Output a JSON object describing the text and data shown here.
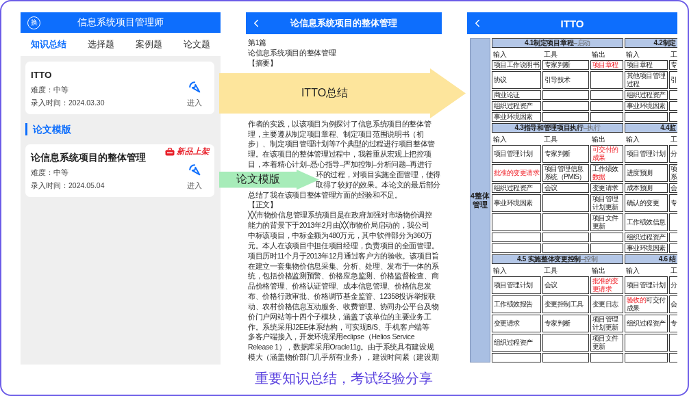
{
  "left_screen": {
    "header": {
      "logo_text": "换",
      "title": "信息系统项目管理师"
    },
    "tabs": [
      {
        "label": "知识总结",
        "selected": true
      },
      {
        "label": "选择题",
        "selected": false
      },
      {
        "label": "案例题",
        "selected": false
      },
      {
        "label": "论文题",
        "selected": false
      }
    ],
    "content": [
      {
        "kind": "card",
        "title": "ITTO",
        "difficulty": "难度：中等",
        "date": "录入时间：2024.03.30",
        "action": "进入"
      },
      {
        "kind": "heading",
        "text": "论文模版"
      },
      {
        "kind": "card",
        "badge": "新品上架",
        "title": "论信息系统项目的整体管理",
        "difficulty": "难度：中等",
        "date": "录入时间：2024.05.04",
        "action": "进入"
      }
    ]
  },
  "middle_screen": {
    "header": {
      "title": "论信息系统项目的整体管理"
    },
    "intro_lines": [
      "第1篇",
      "论信息系统项目的整体管理",
      "【摘要】"
    ],
    "abstract_lines": [
      {
        "kind": "full",
        "text": "作者的实践，以该项目为例探讨了信息系统项目的整体管"
      },
      {
        "kind": "full",
        "text": "理，主要遵从制定项目章程、制定项目范围说明书（初"
      },
      {
        "kind": "full",
        "text": "步）、制定项目管理计划等7个典型的过程进行项目整体管"
      },
      {
        "kind": "full",
        "text": "理。在该项目的整体管理过程中，我着重从宏观上把控项"
      },
      {
        "kind": "full",
        "text": "目，本着精心计划–悉心指导–严加控制–分析问题–再进行"
      },
      {
        "kind": "tail",
        "text": "环的过程，对项目实施全面管理，使得"
      },
      {
        "kind": "tail",
        "text": "取得了较好的效果。本论文的最后部分"
      },
      {
        "kind": "full",
        "text": "总结了我在该项目整体管理方面的经验和不足。"
      }
    ],
    "body_heading": "【正文】",
    "body_lines": [
      "╳╳市物价信息管理系统项目是在政府加强对市场物价调控",
      "能力的背景下于2013年2月由╳╳市物价局启动的，我公司",
      "中标该项目，中标金额为480万元，其中软件部分为360万",
      "元。本人在该项目中担任项目经理，负责项目的全面管理。",
      "项目历时11个月于2013年12月通过客户方的验收。该项目旨",
      "在建立一套集物价信息采集、分析、处理、发布于一体的系",
      "统，包括价格监测预警、价格应急监测、价格监督检查、商",
      "品价格管理、价格认证管理、成本信息管理、价格信息发",
      "布、价格行政审批、价格调节基金监管、12358投诉举报联",
      "动、农村价格信息互动服务、收费管理、协同办公平台及物",
      "价门户网站等十四个子模块，涵盖了该单位的主要业务工",
      "作。系统采用J2EE体系结构，可实现B/S、手机客户端等",
      "多客户端接入，开发环境采用eclipse（Helios Service",
      "Release 1），数据库采用Oracle11g。由于系统具有建设规",
      "模大（涵盖物价部门几乎所有业务），建设时间紧（建设期"
    ]
  },
  "right_screen": {
    "header": {
      "title": "ITTO"
    },
    "group_label": "4整体管理",
    "bands": [
      {
        "blocks": [
          {
            "title": "4.1制定项目章程",
            "phase": "–启动",
            "columns": [
              "输入",
              "工具",
              "输出"
            ],
            "rows": [
              [
                [
                  {
                    "text": "项目工作说明书",
                    "highlighted": false
                  }
                ],
                [
                  {
                    "text": "专家判断",
                    "highlighted": false
                  }
                ],
                [
                  {
                    "text": "项目章程",
                    "highlighted": true
                  }
                ]
              ],
              [
                [
                  {
                    "text": "协议",
                    "highlighted": false
                  }
                ],
                [
                  {
                    "text": "引导技术",
                    "highlighted": false
                  }
                ],
                null
              ],
              [
                [
                  {
                    "text": "商业论证",
                    "highlighted": false
                  }
                ],
                null,
                null
              ],
              [
                [
                  {
                    "text": "组织过程资产",
                    "highlighted": false
                  }
                ],
                null,
                null
              ],
              [
                [
                  {
                    "text": "事业环境因素",
                    "highlighted": false
                  }
                ],
                null,
                null
              ]
            ]
          },
          {
            "title": "4.2制定",
            "columns": [
              "输入",
              "工"
            ],
            "rows": [
              [
                [
                  {
                    "text": "项目章程",
                    "highlighted": false
                  }
                ],
                [
                  {
                    "text": "专",
                    "highlighted": false
                  }
                ]
              ],
              [
                [
                  {
                    "text": "其他项目管理过程",
                    "highlighted": false
                  }
                ],
                [
                  {
                    "text": "引",
                    "highlighted": false
                  }
                ]
              ],
              [
                [
                  {
                    "text": "组织过程资产",
                    "highlighted": false
                  }
                ],
                null
              ],
              [
                [
                  {
                    "text": "事业环境因素",
                    "highlighted": false
                  }
                ],
                null
              ],
              [
                null,
                null
              ]
            ]
          }
        ]
      },
      {
        "blocks": [
          {
            "title": "4.3指导和管理项目执行",
            "phase": "–执行",
            "columns": [
              "输入",
              "工具",
              "输出"
            ],
            "rows": [
              [
                [
                  {
                    "text": "项目管理计划",
                    "highlighted": false
                  }
                ],
                [
                  {
                    "text": "专家判断",
                    "highlighted": false
                  }
                ],
                [
                  {
                    "text": "可交付的成果",
                    "highlighted": true
                  }
                ]
              ],
              [
                [
                  {
                    "text": "批准的变更请求",
                    "highlighted": true
                  }
                ],
                [
                  {
                    "text": "项目管理信息系统（PMIS）",
                    "highlighted": false
                  }
                ],
                [
                  {
                    "text": "工作绩效",
                    "highlighted": false
                  },
                  {
                    "text": "数据",
                    "highlighted": true
                  }
                ]
              ],
              [
                [
                  {
                    "text": "组织过程资产",
                    "highlighted": false
                  }
                ],
                [
                  {
                    "text": "会议",
                    "highlighted": false
                  }
                ],
                [
                  {
                    "text": "变更请求",
                    "highlighted": false
                  }
                ]
              ],
              [
                [
                  {
                    "text": "事业环境因素",
                    "highlighted": false
                  }
                ],
                null,
                [
                  {
                    "text": "项目管理计划更新",
                    "highlighted": false
                  }
                ]
              ],
              [
                null,
                null,
                [
                  {
                    "text": "项目文件更新",
                    "highlighted": false
                  }
                ]
              ],
              [
                null,
                null,
                null
              ],
              [
                null,
                null,
                null
              ]
            ]
          },
          {
            "title": "4.4监",
            "columns": [
              "输入",
              "工"
            ],
            "rows": [
              [
                [
                  {
                    "text": "项目管理计划",
                    "highlighted": false
                  }
                ],
                [
                  {
                    "text": "分",
                    "highlighted": false
                  }
                ]
              ],
              [
                [
                  {
                    "text": "进度预测",
                    "highlighted": false
                  }
                ],
                [
                  {
                    "text": "项系",
                    "highlighted": false
                  }
                ]
              ],
              [
                [
                  {
                    "text": "成本预测",
                    "highlighted": false
                  }
                ],
                [
                  {
                    "text": "会",
                    "highlighted": false
                  }
                ]
              ],
              [
                [
                  {
                    "text": "确认的变更",
                    "highlighted": false
                  }
                ],
                [
                  {
                    "text": "专",
                    "highlighted": false
                  }
                ]
              ],
              [
                [
                  {
                    "text": "工作绩效信息",
                    "highlighted": false
                  }
                ],
                null
              ],
              [
                [
                  {
                    "text": "组织过程资产",
                    "highlighted": false
                  }
                ],
                null
              ],
              [
                [
                  {
                    "text": "事业环境因素",
                    "highlighted": false
                  }
                ],
                null
              ]
            ]
          }
        ]
      },
      {
        "blocks": [
          {
            "title": "4.5 实施整体变更控制",
            "phase": "–控制",
            "columns": [
              "输入",
              "工具",
              "输出"
            ],
            "rows": [
              [
                [
                  {
                    "text": "项目管理计划",
                    "highlighted": false
                  }
                ],
                [
                  {
                    "text": "会议",
                    "highlighted": false
                  }
                ],
                [
                  {
                    "text": "批准的变更请求",
                    "highlighted": true
                  }
                ]
              ],
              [
                [
                  {
                    "text": "工作绩效报告",
                    "highlighted": false
                  }
                ],
                [
                  {
                    "text": "变更控制工具",
                    "highlighted": false
                  }
                ],
                [
                  {
                    "text": "变更日志",
                    "highlighted": false
                  }
                ]
              ],
              [
                [
                  {
                    "text": "变更请求",
                    "highlighted": false
                  }
                ],
                [
                  {
                    "text": "专家判断",
                    "highlighted": false
                  }
                ],
                [
                  {
                    "text": "项目管理计划更新",
                    "highlighted": false
                  }
                ]
              ],
              [
                [
                  {
                    "text": "组织过程资产",
                    "highlighted": false
                  }
                ],
                null,
                [
                  {
                    "text": "项目文件更新",
                    "highlighted": false
                  }
                ]
              ],
              [
                null,
                null,
                null
              ]
            ]
          },
          {
            "title": "4.6 结",
            "columns": [
              "输入",
              "工"
            ],
            "rows": [
              [
                [
                  {
                    "text": "项目管理计划",
                    "highlighted": false
                  }
                ],
                [
                  {
                    "text": "分",
                    "highlighted": false
                  }
                ]
              ],
              [
                [
                  {
                    "text": "验收的",
                    "highlighted": true
                  },
                  {
                    "text": "可交付成果",
                    "highlighted": false
                  }
                ],
                [
                  {
                    "text": "会",
                    "highlighted": false
                  }
                ]
              ],
              [
                [
                  {
                    "text": "组织过程资产",
                    "highlighted": false
                  }
                ],
                [
                  {
                    "text": "专",
                    "highlighted": false
                  }
                ]
              ],
              [
                null,
                null
              ],
              [
                null,
                null
              ]
            ]
          }
        ]
      }
    ]
  },
  "callouts": [
    {
      "text": "ITTO总结",
      "color": "#fde59c"
    },
    {
      "text": "论文模版",
      "color": "#a7ecb9"
    }
  ],
  "caption": "重要知识总结，考试经验分享"
}
